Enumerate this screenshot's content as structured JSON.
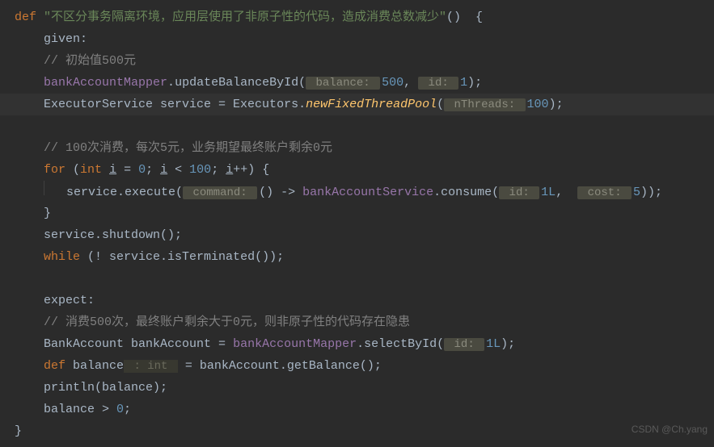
{
  "code": {
    "def": "def",
    "title_string": "\"不区分事务隔离环境，应用层使用了非原子性的代码，造成消费总数减少\"",
    "brace_open": "()  {",
    "given": "given:",
    "comment1": "// 初始值500元",
    "bankMapper": "bankAccountMapper",
    "dot1": ".",
    "updateMethod": "updateBalanceById(",
    "hint_balance": " balance: ",
    "val_500": "500",
    "comma1": ", ",
    "hint_id": " id: ",
    "val_1": "1",
    "close1": ");",
    "executorDecl": "ExecutorService service = Executors.",
    "newPool": "newFixedThreadPool",
    "poolOpen": "(",
    "hint_threads": " nThreads: ",
    "val_100": "100",
    "poolClose": ");",
    "comment2": "// 100次消费，每次5元，业务期望最终账户剩余0元",
    "for_kw": "for",
    "for_open": " (",
    "int_kw": "int",
    "space": " ",
    "i_var": "i",
    "eq": " = ",
    "zero": "0",
    "semi": "; ",
    "lt": " < ",
    "hundred": "100",
    "semi2": "; ",
    "inc": "++",
    "for_close": ") {",
    "service_exec": "service.execute(",
    "hint_command": " command: ",
    "lambda": "() -> ",
    "bankService": "bankAccountService",
    "dot2": ".",
    "consume": "consume(",
    "hint_id2": " id: ",
    "val_1L": "1L",
    "comma2": ",  ",
    "hint_cost": " cost: ",
    "val_5": "5",
    "exec_close": "));",
    "brace_close": "}",
    "shutdown": "service.shutdown();",
    "while_kw": "while",
    "while_cond": " (! service.isTerminated());",
    "expect": "expect:",
    "comment3": "// 消费500次，最终账户剩余大于0元，则非原子性的代码存在隐患",
    "bankAccDecl": "BankAccount bankAccount = ",
    "selectById": ".selectById(",
    "hint_id3": " id: ",
    "val_1L2": "1L",
    "select_close": ");",
    "def2": "def",
    "balance_var": " balance",
    "type_int": " : int ",
    "eq2": " = bankAccount.getBalance();",
    "println": "println(balance);",
    "balance_gt": "balance > ",
    "zero2": "0",
    "semi3": ";",
    "final_brace": "}"
  },
  "watermark": "CSDN @Ch.yang"
}
